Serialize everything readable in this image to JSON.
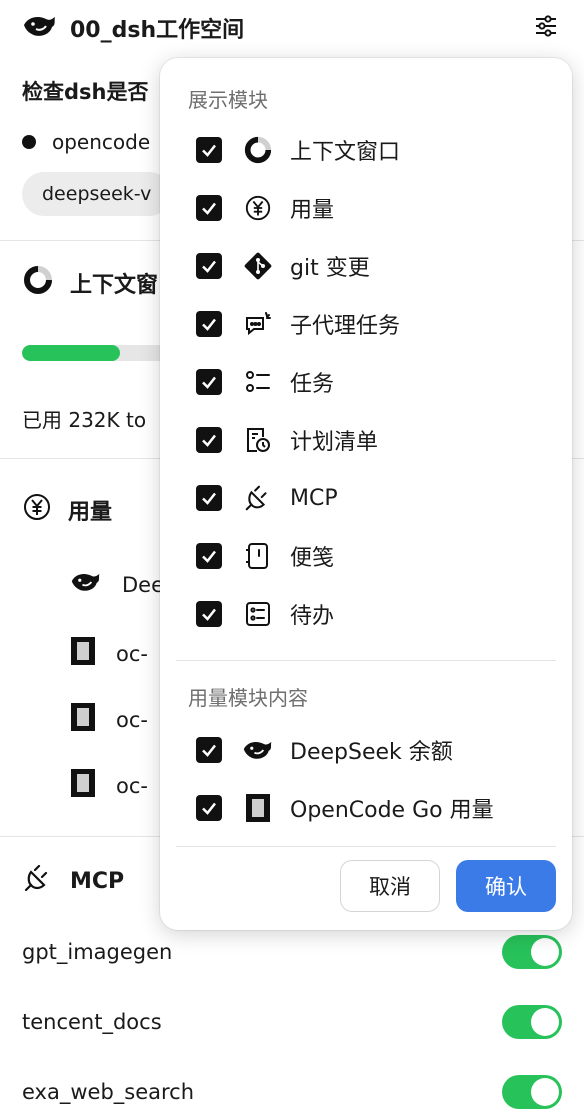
{
  "header": {
    "workspace_title": "00_dsh工作空间"
  },
  "session": {
    "title": "检查dsh是否",
    "agent_label": "opencode",
    "model_chip": "deepseek-v"
  },
  "context_section": {
    "title": "上下文窗",
    "progress_fraction": 0.49,
    "usage_text": "已用 232K to"
  },
  "usage_section": {
    "title": "用量",
    "items": [
      {
        "label": "Dee"
      },
      {
        "label": "oc-"
      },
      {
        "label": "oc-"
      },
      {
        "label": "oc-"
      }
    ]
  },
  "mcp_section": {
    "title": "MCP",
    "servers": [
      {
        "name": "gpt_imagegen",
        "enabled": true
      },
      {
        "name": "tencent_docs",
        "enabled": true
      },
      {
        "name": "exa_web_search",
        "enabled": true
      }
    ]
  },
  "popup": {
    "group1_title": "展示模块",
    "modules": [
      {
        "label": "上下文窗口",
        "icon": "context-ring-icon",
        "checked": true
      },
      {
        "label": "用量",
        "icon": "yen-icon",
        "checked": true
      },
      {
        "label": "git 变更",
        "icon": "git-icon",
        "checked": true
      },
      {
        "label": "子代理任务",
        "icon": "subagent-icon",
        "checked": true
      },
      {
        "label": "任务",
        "icon": "task-list-icon",
        "checked": true
      },
      {
        "label": "计划清单",
        "icon": "plan-icon",
        "checked": true
      },
      {
        "label": "MCP",
        "icon": "plug-icon",
        "checked": true
      },
      {
        "label": "便笺",
        "icon": "note-icon",
        "checked": true
      },
      {
        "label": "待办",
        "icon": "todo-icon",
        "checked": true
      }
    ],
    "group2_title": "用量模块内容",
    "usage_content": [
      {
        "label": "DeepSeek 余额",
        "icon": "deepseek-whale-icon",
        "checked": true
      },
      {
        "label": "OpenCode Go 用量",
        "icon": "opencode-icon",
        "checked": true
      }
    ],
    "cancel_label": "取消",
    "confirm_label": "确认"
  },
  "colors": {
    "accent": "#3b7be8",
    "toggle_on": "#27c25a",
    "progress": "#27c25a"
  }
}
